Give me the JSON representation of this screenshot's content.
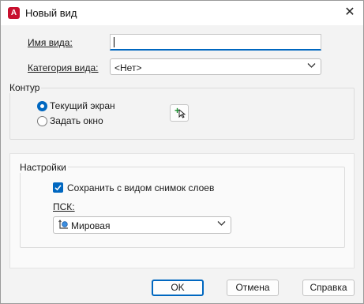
{
  "window": {
    "title": "Новый вид",
    "app_icon_letter": "A",
    "close_glyph": "✕"
  },
  "view_name": {
    "label": "Имя вида:",
    "value": ""
  },
  "view_category": {
    "label": "Категория вида:",
    "selected": "<Нет>"
  },
  "boundary": {
    "title": "Контур",
    "option_current": "Текущий экран",
    "option_define": "Задать окно",
    "selected": "current"
  },
  "settings": {
    "title": "Настройки",
    "save_layer_snapshot_label": "Сохранить с видом снимок слоев",
    "save_layer_snapshot_checked": true,
    "ucs_label": "ПСК:",
    "ucs_selected": "Мировая"
  },
  "buttons": {
    "ok": "OK",
    "cancel": "Отмена",
    "help": "Справка"
  },
  "icons": {
    "app": "autocad-app-icon",
    "close": "close-icon",
    "chevron": "chevron-down-icon",
    "pick": "pick-window-icon",
    "ucs": "ucs-icon"
  },
  "colors": {
    "accent": "#0067c0",
    "app_icon": "#c8102e"
  }
}
